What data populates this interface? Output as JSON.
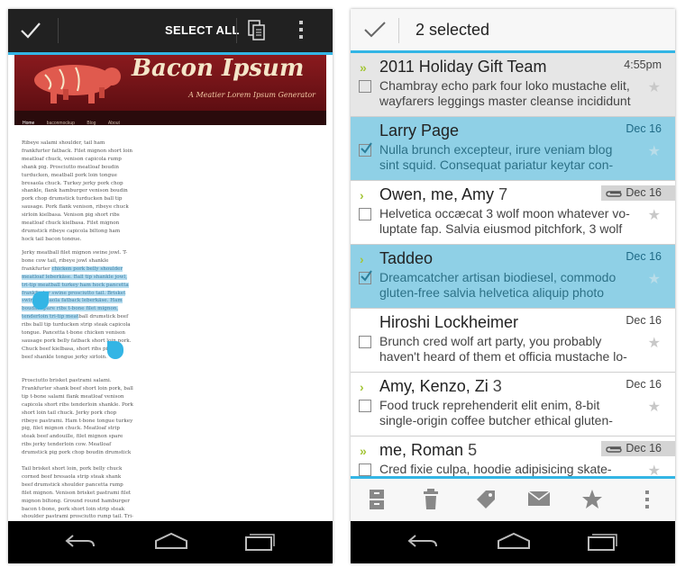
{
  "left_phone": {
    "action_bar": {
      "done_icon": "checkmark-icon",
      "select_all_label": "SELECT ALL",
      "copy_icon": "copy-icon",
      "overflow_icon": "overflow-menu-icon"
    },
    "webpage": {
      "site_title": "Bacon Ipsum",
      "tagline": "A Meatier Lorem Ipsum Generator",
      "nav_links": [
        "Home",
        "baconmockup",
        "Blog",
        "About"
      ],
      "paragraph1": "Ribeye salami shoulder, tail ham frankfurter fatback. Filet mignon short loin meatloaf chuck, venison capicola rump shank pig. Prosciutto meatloaf boudin turducken, meatball pork loin tongue bresaola chuck. Turkey jerky pork chop shankle, flank hamburger venison boudin pork chop drumstick turducken ball tip sausage. Pork flank venison, ribeye chuck sirloin kielbasa. Venison pig short ribs meatloaf chuck kielbasa. Filet mignon drumstick ribeye capicola biltong ham hock tail bacon tongue.",
      "paragraph2_before": "Jerky meatball filet mignon swine jowl. T-bone cow tail, ribeye jowl shankle frankfurter ",
      "paragraph2_selected": "chicken pork belly shoulder meatloaf leberkäse. Ball tip shankle jowl, tri-tip meatball turkey ham hock pancetta frankfurter swine prosciutto tail. Brisket swine bresaola fatback leberkäse. Ham boudin spare ribs t-bone filet mignon, tenderloin tri-tip meat",
      "paragraph2_after": "ball drumstick beef ribs ball tip turducken strip steak capicola tongue. Pancetta t-bone chicken venison sausage pork belly fatback short loin pork. Chuck beef kielbasa, short ribs pig jowl beef shankle tongue jerky sirloin.",
      "paragraph3": "Prosciutto brisket pastrami salami. Frankfurter shank beef short loin pork, ball tip t-bone salami flank meatloaf venison capicola short ribs tenderloin shankle. Pork short loin tail chuck. Jerky pork chop ribeye pastrami. Ham t-bone tongue turkey pig, filet mignon chuck. Meatloaf strip steak beef andouille, filet mignon spare ribs jerky tenderloin cow. Meatloaf drumstick pig pork chop boudin drumstick sausage.",
      "paragraph4": "Tail brisket short loin, pork belly chuck corned beef bresaola strip steak shank beef drumstick shoulder pancetta rump filet mignon. Venison brisket pastrami filet mignon biltong. Ground round hamburger bacon t-bone, pork short loin strip steak shoulder pastrami prosciutto rump tail. Tri-tip capicola short ribs, hamburger pork"
    },
    "nav_bar": [
      "back-icon",
      "home-icon",
      "recent-apps-icon"
    ]
  },
  "right_phone": {
    "action_bar": {
      "done_icon": "checkmark-icon",
      "selected_count": "2 selected"
    },
    "messages": [
      {
        "sender": "2011 Holiday Gift Team",
        "count": "",
        "date": "4:55pm",
        "snippet1": "Chambray echo park four loko mustache elit,",
        "snippet2": "wayfarers leggings master cleanse incididunt",
        "unread": true,
        "selected": false,
        "chevron": "double",
        "attachment": false
      },
      {
        "sender": "Larry Page",
        "count": "",
        "date": "Dec 16",
        "snippet1": "Nulla brunch excepteur, irure veniam blog",
        "snippet2": "sint squid. Consequat pariatur keytar con-",
        "unread": false,
        "selected": true,
        "chevron": "none",
        "attachment": false
      },
      {
        "sender": "Owen, me, Amy",
        "count": "7",
        "date": "Dec 16",
        "snippet1": "Helvetica occæcat 3 wolf moon whatever vo-",
        "snippet2": "luptate fap. Salvia eiusmod pitchfork, 3 wolf",
        "unread": false,
        "selected": false,
        "chevron": "single",
        "attachment": true
      },
      {
        "sender": "Taddeo",
        "count": "",
        "date": "Dec 16",
        "snippet1": "Dreamcatcher artisan biodiesel, commodo",
        "snippet2": "gluten-free salvia helvetica aliquip photo",
        "unread": false,
        "selected": true,
        "chevron": "single",
        "attachment": false
      },
      {
        "sender": "Hiroshi Lockheimer",
        "count": "",
        "date": "Dec 16",
        "snippet1": "Brunch cred wolf art party, you probably",
        "snippet2": "haven't heard of them et officia mustache lo-",
        "unread": false,
        "selected": false,
        "chevron": "none",
        "attachment": false
      },
      {
        "sender": "Amy, Kenzo, Zi",
        "count": "3",
        "date": "Dec 16",
        "snippet1": "Food truck reprehenderit elit enim, 8-bit",
        "snippet2": "single-origin coffee butcher ethical gluten-",
        "unread": false,
        "selected": false,
        "chevron": "single",
        "attachment": false
      },
      {
        "sender": "me, Roman",
        "count": "5",
        "date": "Dec 16",
        "snippet1": "Cred fixie culpa, hoodie adipisicing skate-",
        "snippet2": "",
        "unread": false,
        "selected": false,
        "chevron": "double",
        "attachment": true
      }
    ],
    "bottom_actions": [
      "archive-icon",
      "delete-icon",
      "label-icon",
      "mark-unread-icon",
      "star-icon",
      "overflow-menu-icon"
    ],
    "nav_bar": [
      "back-icon",
      "home-icon",
      "recent-apps-icon"
    ]
  },
  "colors": {
    "holo_blue": "#33b5e5",
    "selected_row": "#8fd0e6",
    "android_green": "#a4c639",
    "banner_red": "#7b1418"
  }
}
